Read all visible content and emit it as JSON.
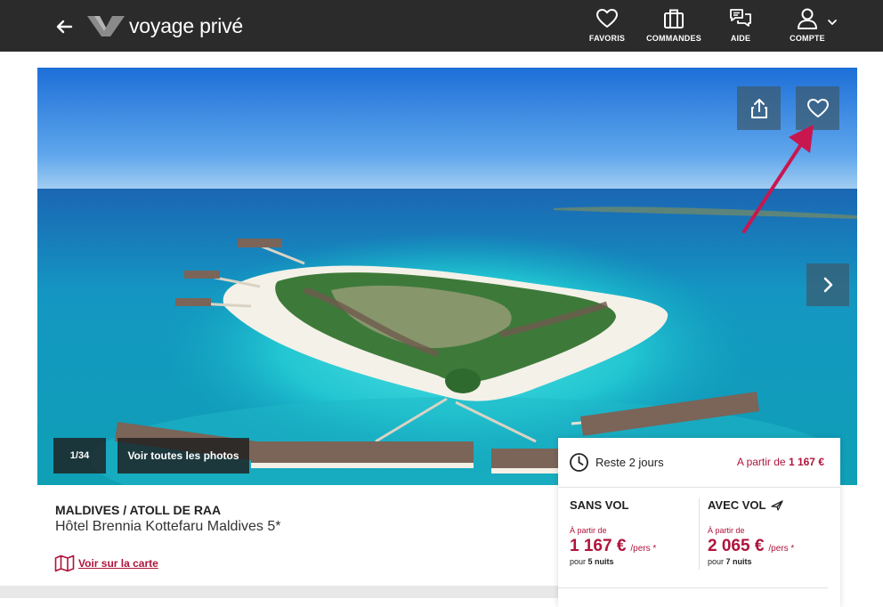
{
  "header": {
    "logo_text": "voyage privé",
    "nav": {
      "favoris": "FAVORIS",
      "commandes": "COMMANDES",
      "aide": "AIDE",
      "compte": "COMPTE"
    }
  },
  "gallery": {
    "counter": "1/34",
    "all_photos": "Voir toutes les photos"
  },
  "product": {
    "region": "MALDIVES / ATOLL DE RAA",
    "hotel_name": "Hôtel Brennia Kottefaru Maldives 5*",
    "map_link": "Voir sur la carte"
  },
  "pricing": {
    "remaining": "Reste 2 jours",
    "from_label": "A partir de",
    "from_price": "1 167 €",
    "without_flight": {
      "title": "SANS VOL",
      "from_label": "À partir de",
      "price": "1 167 €",
      "per": "/pers *",
      "nights_prefix": "pour",
      "nights": "5 nuits"
    },
    "with_flight": {
      "title": "AVEC VOL",
      "from_label": "À partir de",
      "price": "2 065 €",
      "per": "/pers *",
      "nights_prefix": "pour",
      "nights": "7 nuits"
    }
  },
  "colors": {
    "header_bg": "#2b2b2b",
    "accent": "#b0143c",
    "annotation_arrow": "#c8174f"
  },
  "icons": [
    "back-arrow-icon",
    "logo-v-icon",
    "heart-icon",
    "briefcase-icon",
    "chat-icon",
    "user-icon",
    "chevron-down-icon",
    "share-icon",
    "chevron-right-icon",
    "clock-icon",
    "plane-icon",
    "map-icon"
  ]
}
